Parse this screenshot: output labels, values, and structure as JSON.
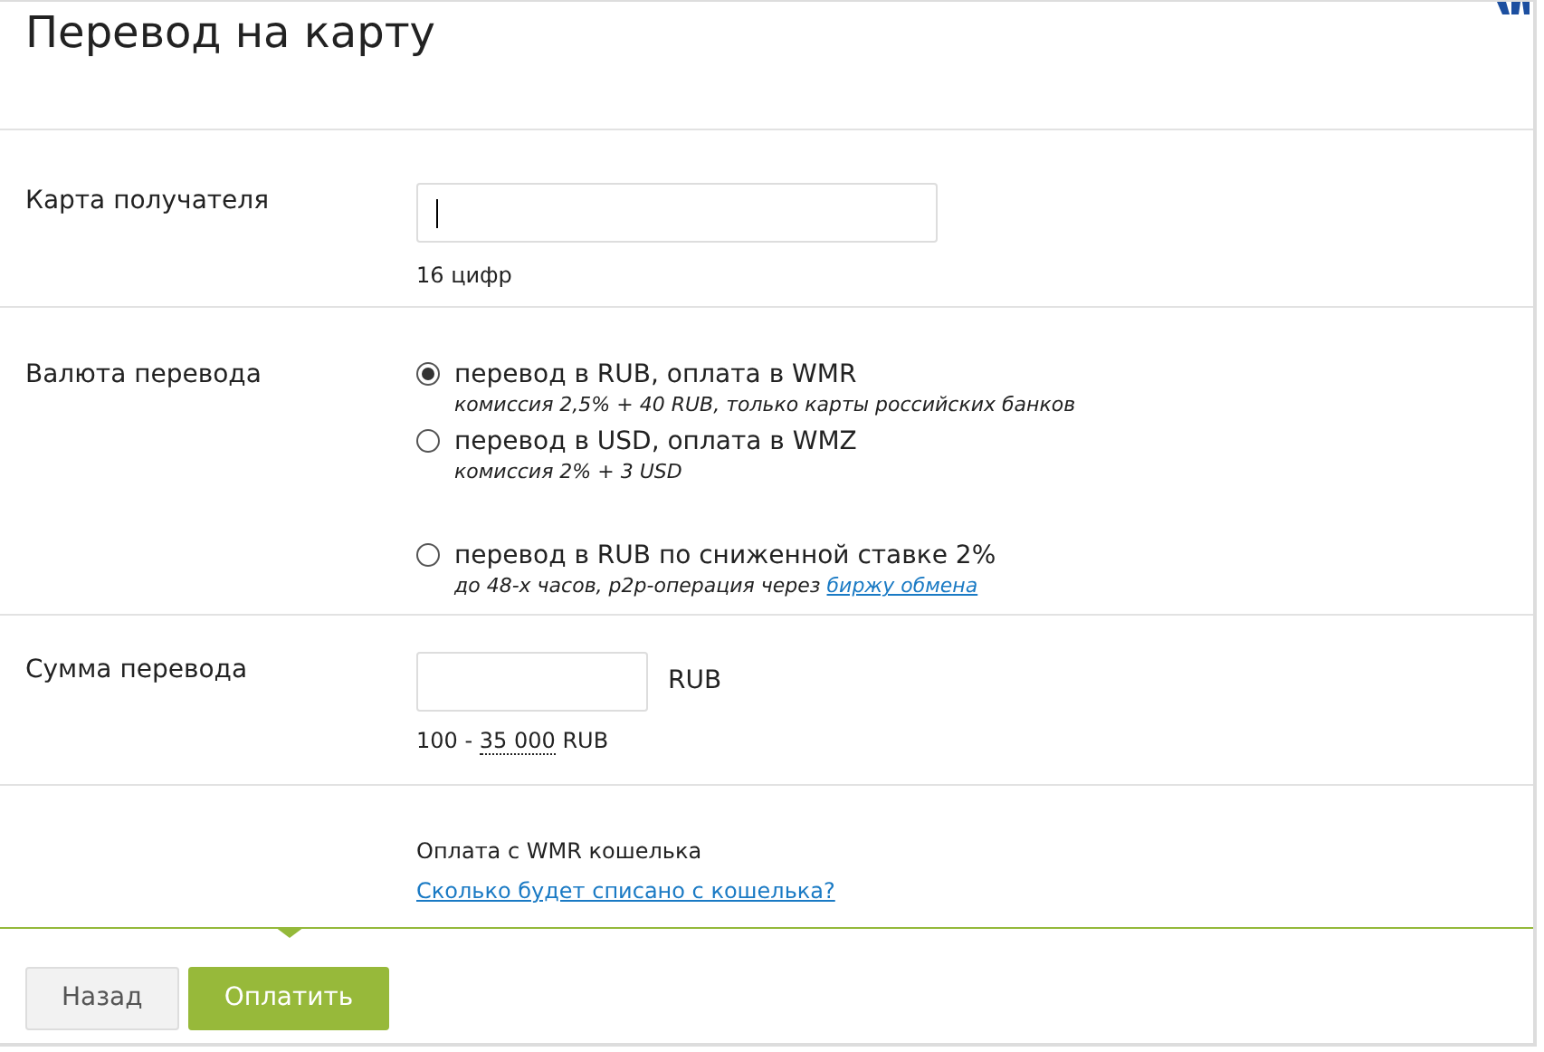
{
  "title": "Перевод на карту",
  "card": {
    "label": "Карта получателя",
    "focused": true,
    "hint": "16 цифр"
  },
  "currency": {
    "label": "Валюта перевода",
    "options": [
      {
        "label": "перевод в RUB, оплата в WMR",
        "note": "комиссия 2,5% + 40 RUB, только карты российских банков",
        "selected": true
      },
      {
        "label": "перевод в USD, оплата в WMZ",
        "note": "комиссия 2% + 3 USD",
        "selected": false
      },
      {
        "label": "перевод в RUB по сниженной ставке 2%",
        "note": "до 48-х часов, p2p-операция через",
        "link": "биржу обмена",
        "selected": false
      }
    ]
  },
  "amount": {
    "label": "Сумма перевода",
    "unit": "RUB",
    "range_min": "100 -",
    "range_max": "35 000",
    "range_unit": "RUB"
  },
  "payment": {
    "source": "Оплата с WMR кошелька",
    "link": "Сколько будет списано с кошелька?"
  },
  "buttons": [
    {
      "label": "Назад",
      "kind": "secondary"
    },
    {
      "label": "Оплатить",
      "kind": "primary"
    }
  ]
}
